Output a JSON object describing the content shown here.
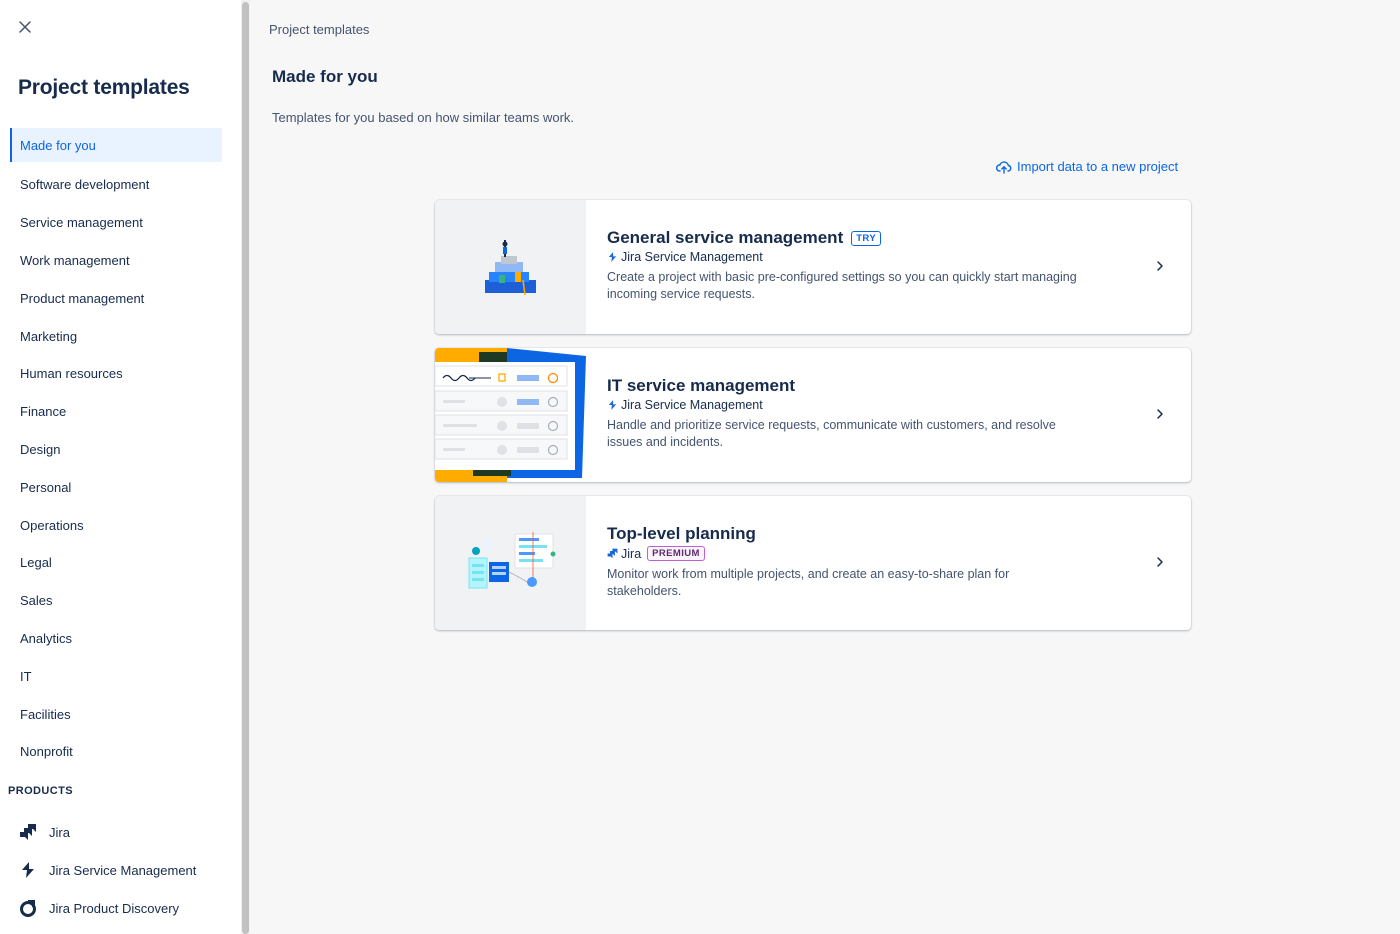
{
  "sidebar": {
    "title": "Project templates",
    "close_label": "Close",
    "categories": [
      "Made for you",
      "Software development",
      "Service management",
      "Work management",
      "Product management",
      "Marketing",
      "Human resources",
      "Finance",
      "Design",
      "Personal",
      "Operations",
      "Legal",
      "Sales",
      "Analytics",
      "IT",
      "Facilities",
      "Nonprofit"
    ],
    "active_category": "Made for you",
    "products_heading": "PRODUCTS",
    "products": [
      {
        "label": "Jira",
        "icon": "jira-icon"
      },
      {
        "label": "Jira Service Management",
        "icon": "jira-service-management-icon"
      },
      {
        "label": "Jira Product Discovery",
        "icon": "jira-product-discovery-icon"
      }
    ]
  },
  "main": {
    "breadcrumb": "Project templates",
    "title": "Made for you",
    "subtitle": "Templates for you based on how similar teams work.",
    "import_link": "Import data to a new project",
    "cards": [
      {
        "title": "General service management",
        "badge": "TRY",
        "product": "Jira Service Management",
        "description": "Create a project with basic pre-configured settings so you can quickly start managing incoming service requests."
      },
      {
        "title": "IT service management",
        "badge": "",
        "product": "Jira Service Management",
        "description": "Handle and prioritize service requests, communicate with customers, and resolve issues and incidents."
      },
      {
        "title": "Top-level planning",
        "badge": "PREMIUM",
        "product": "Jira",
        "description": "Monitor work from multiple projects, and create an easy-to-share plan for stakeholders."
      }
    ]
  },
  "colors": {
    "accent": "#0c66e4",
    "active_bg": "#e9f2ff",
    "text": "#172b4d",
    "subtle_text": "#44546f",
    "premium": "#c05fd6"
  }
}
